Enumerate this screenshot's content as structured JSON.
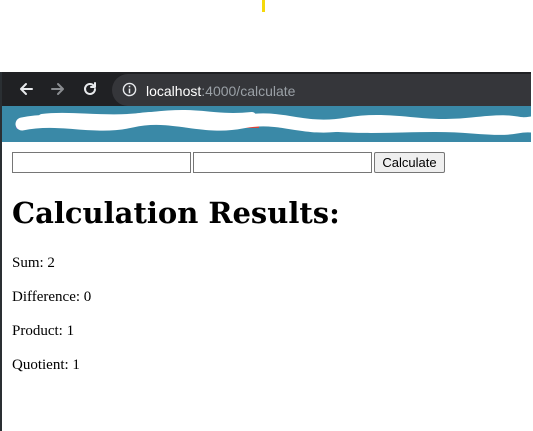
{
  "browser": {
    "url_host": "localhost",
    "url_path": ":4000/calculate"
  },
  "form": {
    "input1_value": "",
    "input2_value": "",
    "button_label": "Calculate"
  },
  "results": {
    "heading": "Calculation Results:",
    "items": [
      {
        "label": "Sum:",
        "value": "2",
        "text": "Sum: 2"
      },
      {
        "label": "Difference:",
        "value": "0",
        "text": "Difference: 0"
      },
      {
        "label": "Product:",
        "value": "1",
        "text": "Product: 1"
      },
      {
        "label": "Quotient:",
        "value": "1",
        "text": "Quotient: 1"
      }
    ]
  },
  "colors": {
    "toolbar": "#202124",
    "omnibox": "#35363a",
    "bookmarks_bar": "#3a89a7",
    "redaction": "#ffffff"
  },
  "icons": {
    "back": "arrow-left-icon",
    "forward": "arrow-right-icon",
    "reload": "reload-icon",
    "info": "info-icon"
  }
}
